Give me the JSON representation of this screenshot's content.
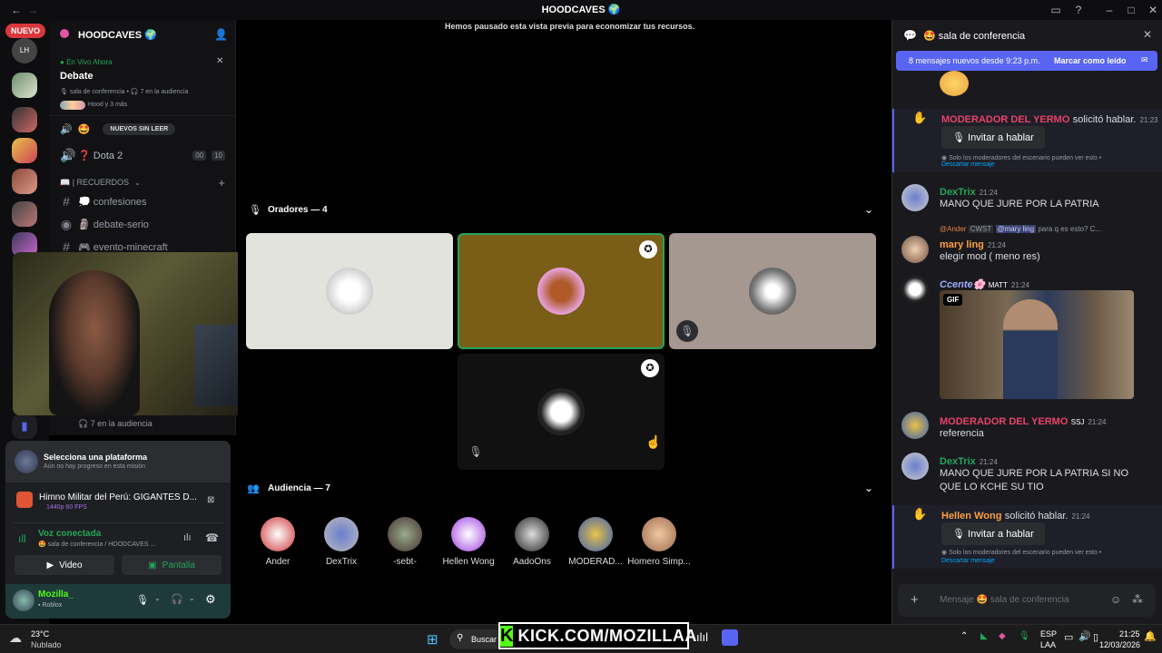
{
  "window": {
    "title": "HOODCAVES 🌍"
  },
  "rail": {
    "new_badge": "NUEVO",
    "lh_label": "LH"
  },
  "sidebar": {
    "server_name": "HOODCAVES 🌍",
    "live": {
      "status": "En Vivo Ahora",
      "title": "Debate",
      "detail": "🎙 sala de conferencia • 🎧 7 en la audiencia",
      "people": "Hood y 3 más"
    },
    "new_unread": "NUEVOS SIN LEER",
    "voice_channel": {
      "name": "❓ Dota 2",
      "count_a": "00",
      "count_b": "10"
    },
    "category": "📖 | RECUERDOS",
    "channels": [
      "💭 confesiones",
      "🗿 debate-serio",
      "🎮 evento-minecraft"
    ],
    "audience_footer": "7 en la audiencia"
  },
  "user_panel": {
    "quest_title": "Selecciona una plataforma",
    "quest_sub": "Aún no hay progreso en esta misión",
    "stream_title": "Himno Militar del Perú: GIGANTES D...",
    "stream_meta": "1440p 60 FPS",
    "voice_status": "Voz conectada",
    "voice_location": "sala de conferencia / HOODCAVES ...",
    "video_button": "Video",
    "screen_button": "Pantalla",
    "username": "Mozilla_",
    "activity": "Roblox"
  },
  "stage": {
    "paused_notice": "Hemos pausado esta vista previa para economizar tus recursos.",
    "speakers_header": "Oradores — 4",
    "audience_header": "Audiencia — 7",
    "audience": [
      "Ander",
      "DexTrix",
      "-sebt-",
      "Hellen Wong",
      "AadoOns",
      "MODERAD...",
      "Homero Simp..."
    ]
  },
  "chat": {
    "header": "🤩 sala de conferencia",
    "new_messages_banner": "8 mensajes nuevos desde 9:23 p.m.",
    "mark_read": "Marcar como leído",
    "messages": [
      {
        "user": "MODERADOR DEL YERMO",
        "action": "solicitó hablar.",
        "time": "21:23",
        "invite": "Invitar a hablar",
        "note": "Solo los moderadores del escenario pueden ver esto •",
        "dismiss": "Descartar mensaje"
      },
      {
        "user": "DexTrix",
        "time": "21:24",
        "text": "MANO QUE JURE POR LA PATRIA"
      },
      {
        "reply_user": "@Ander",
        "reply_tag": "CWST",
        "reply_mention": "@mary ling",
        "reply_text": "para q es esto? C...",
        "user": "mary ling",
        "time": "21:24",
        "text": "elegir mod ( meno res)"
      },
      {
        "user": "Ccente🌸",
        "tag": "MATT",
        "time": "21:24",
        "gif_label": "GIF"
      },
      {
        "user": "MODERADOR DEL YERMO",
        "tag": "SSJ",
        "time": "21:24",
        "text": "referencia"
      },
      {
        "user": "DexTrix",
        "time": "21:24",
        "text": "MANO QUE JURE POR LA PATRIA SI NO QUE LO KCHE SU TIO"
      },
      {
        "user": "Hellen Wong",
        "action": "solicitó hablar.",
        "time": "21:24",
        "invite": "Invitar a hablar",
        "note": "Solo los moderadores del escenario pueden ver esto •",
        "dismiss": "Descartar mensaje"
      }
    ],
    "input_placeholder": "Mensaje 🤩 sala de conferencia"
  },
  "taskbar": {
    "weather_temp": "23°C",
    "weather_desc": "Nublado",
    "search": "Buscar",
    "kick_banner": "KICK.COM/MOZILLAA",
    "lang_top": "ESP",
    "lang_bottom": "LAA",
    "time": "21:25",
    "date": "12/03/2026"
  },
  "colors": {
    "accent": "#5865f2",
    "green": "#23a55a",
    "mod_red": "#e9426a",
    "kick_green": "#53fc18"
  }
}
